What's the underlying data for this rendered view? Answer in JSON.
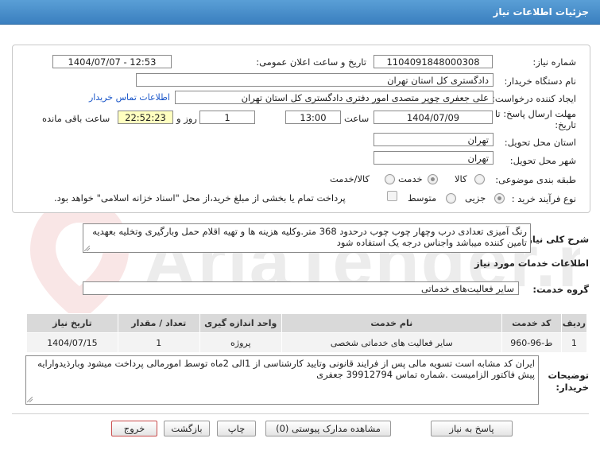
{
  "header": {
    "title": "جزئیات اطلاعات نیاز"
  },
  "need_number": {
    "label": "شماره نیاز:",
    "value": "1104091848000308"
  },
  "announce_datetime": {
    "label": "تاریخ و ساعت اعلان عمومی:",
    "value": "1404/07/07 - 12:53"
  },
  "buyer_org": {
    "label": "نام دستگاه خریدار:",
    "value": "دادگستری کل استان تهران"
  },
  "creator": {
    "label": "ایجاد کننده درخواست:",
    "value": "علی جعفری چوپر متصدی امور دفتری دادگستری کل استان تهران",
    "contact_link": "اطلاعات تماس خریدار"
  },
  "deadline": {
    "label_line1": "مهلت ارسال پاسخ: تا",
    "label_line2": "تاریخ:",
    "date": "1404/07/09",
    "time_label": "ساعت",
    "time": "13:00",
    "days": "1",
    "days_label": "روز و",
    "remaining": "22:52:23",
    "remaining_label": "ساعت باقی مانده"
  },
  "delivery_province": {
    "label": "استان محل تحویل:",
    "value": "تهران"
  },
  "delivery_city": {
    "label": "شهر محل تحویل:",
    "value": "تهران"
  },
  "category": {
    "label": "طبقه بندی موضوعی:",
    "options": [
      "کالا",
      "خدمت",
      "کالا/خدمت"
    ],
    "selected": "خدمت"
  },
  "purchase_type": {
    "label": "نوع فرآیند خرید :",
    "options": [
      "جزیی",
      "متوسط"
    ],
    "selected": "جزیی",
    "treasury_note": "پرداخت تمام یا بخشی از مبلغ خرید،از محل \"اسناد خزانه اسلامی\" خواهد بود."
  },
  "general_description": {
    "label": "شرح کلی نیاز:",
    "value": "رنگ آمیزی تعدادی درب وچهار چوب چوب درحدود 368 متر.وکلیه هزینه ها و تهیه اقلام  حمل وبارگیری وتخلیه  بعهدیه تامین کننده میباشد واجناس درجه یک استفاده شود"
  },
  "services_section": {
    "title": "اطلاعات خدمات مورد نیاز"
  },
  "service_group": {
    "label": "گروه خدمت:",
    "value": "سایر فعالیت‌های خدماتی"
  },
  "services_table": {
    "headers": [
      "ردیف",
      "کد خدمت",
      "نام خدمت",
      "واحد اندازه گیری",
      "تعداد / مقدار",
      "تاریخ نیاز"
    ],
    "rows": [
      [
        "1",
        "ط-96-960",
        "سایر فعالیت های خدماتی شخصی",
        "پروژه",
        "1",
        "1404/07/15"
      ]
    ]
  },
  "buyer_notes": {
    "label_line1": "توضیحات",
    "label_line2": "خریدار:",
    "value": "ایران کد مشابه است تسویه مالی پس از فرایند قانونی وتایید کارشناسی از 1الی 2ماه توسط امورمالی  پرداخت میشود وبارذیدوارایه پیش فاکتور الزامیست .شماره تماس 39912794 جعفری"
  },
  "buttons": {
    "respond": "پاسخ به نیاز",
    "attachments": "مشاهده مدارک پیوستی (0)",
    "print": "چاپ",
    "back": "بازگشت",
    "exit": "خروج"
  },
  "watermark": {
    "text": "AriaTender.net"
  },
  "colors": {
    "header": "#3a7fbf",
    "link": "#1a56c9",
    "remaining_bg": "#ffffc0",
    "exit_border": "#c94b4b"
  }
}
